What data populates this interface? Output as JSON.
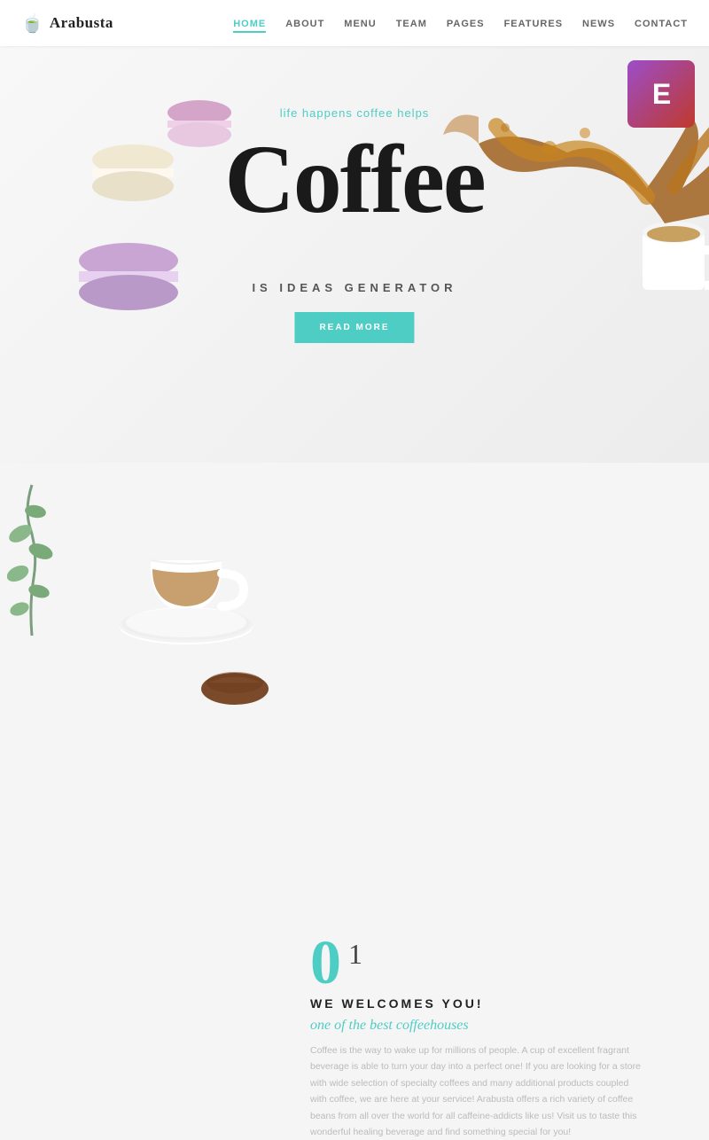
{
  "navbar": {
    "brand": "Arabusta",
    "brand_icon": "☕",
    "nav_items": [
      {
        "label": "HOME",
        "active": true
      },
      {
        "label": "ABOUT",
        "active": false
      },
      {
        "label": "MENU",
        "active": false
      },
      {
        "label": "TEAM",
        "active": false
      },
      {
        "label": "PAGES",
        "active": false
      },
      {
        "label": "FEATURES",
        "active": false
      },
      {
        "label": "NEWS",
        "active": false
      },
      {
        "label": "CONTACT",
        "active": false
      }
    ]
  },
  "hero": {
    "subtitle": "life happens coffee helps",
    "title": "Coffee",
    "tagline": "IS IDEAS GENERATOR",
    "btn_label": "READ MORE"
  },
  "elementor_badge": {
    "text": "E"
  },
  "about": {
    "number": "0",
    "heading": "WE WELCOMES YOU!",
    "subheading": "one of the best coffeehouses",
    "text": "Coffee is the way to wake up for millions of people. A cup of excellent fragrant beverage is able to turn your day into a perfect one! If you are looking for a store with wide selection of specialty coffees and many additional products coupled with coffee, we are here at your service! Arabusta offers a rich variety of coffee beans from all over the world for all caffeine-addicts like us! Visit us to taste this wonderful healing beverage and find something special for you!"
  },
  "colors": {
    "teal": "#4ecdc4",
    "dark": "#1a1a1a",
    "light_gray": "#f5f5f5",
    "white": "#ffffff",
    "elementor_gradient_start": "#9b4dca",
    "elementor_gradient_end": "#c0392b"
  }
}
